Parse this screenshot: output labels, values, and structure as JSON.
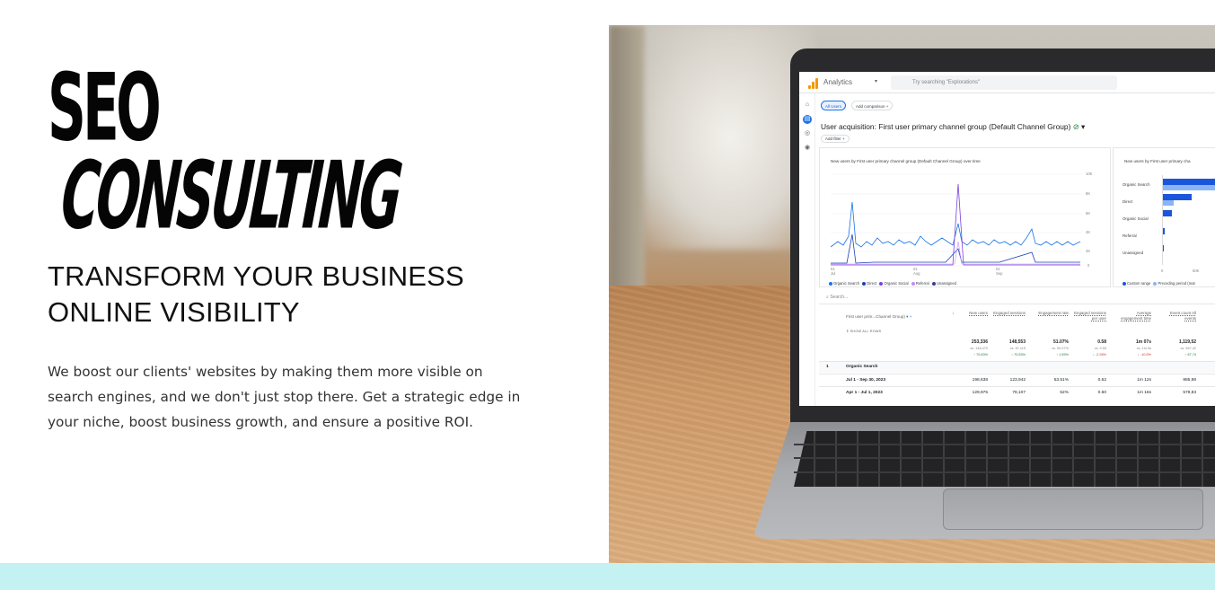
{
  "hero": {
    "title_line1": "SEO",
    "title_line2": "CONSULTING",
    "subtitle": "TRANSFORM YOUR BUSINESS ONLINE VISIBILITY",
    "description": "We boost our clients' websites by making them more visible on search engines, and we don't just stop there. Get a strategic edge in your niche, boost business growth, and ensure a positive ROI."
  },
  "colors": {
    "title_text": "#050505",
    "bottom_strip": "#c4f2f2",
    "ga_blue": "#1a73e8",
    "ga_orange": "#f29900"
  },
  "analytics": {
    "app_name": "Analytics",
    "search_placeholder": "Try searching \"Explorations\"",
    "chip_all_users": "All Users",
    "chip_add_comparison": "Add comparison",
    "heading": "User acquisition: First user primary channel group (Default Channel Group)",
    "add_filter": "Add filter",
    "line_chart_title": "New users by First user primary channel group (Default Channel Group) over time",
    "bar_chart_title": "New users by First user primary cha",
    "y_ticks": [
      "10K",
      "8K",
      "6K",
      "4K",
      "2K",
      "0"
    ],
    "x_ticks": [
      {
        "day": "01",
        "month": "Jul"
      },
      {
        "day": "01",
        "month": "Aug"
      },
      {
        "day": "01",
        "month": "Sep"
      }
    ],
    "line_legend": [
      "Organic Search",
      "Direct",
      "Organic Social",
      "Referral",
      "Unassigned"
    ],
    "bar_categories": [
      "Organic Search",
      "Direct",
      "Organic Social",
      "Referral",
      "Unassigned"
    ],
    "bar_x_ticks": [
      "0",
      "50K"
    ],
    "bar_legend": [
      "Custom range",
      "Preceding period (mat"
    ],
    "table": {
      "search": "Search...",
      "dimension_header": "First user prim...Channel Group)",
      "show_all_rows": "SHOW ALL ROWS",
      "columns": [
        "New users",
        "Engaged sessions",
        "Engagement rate",
        "Engaged sessions per user",
        "Average engagement time",
        "Event count All events"
      ],
      "totals": [
        "253,336",
        "148,553",
        "51.07%",
        "0.58",
        "1m 07s",
        "1,119,52"
      ],
      "totals_vs": [
        "vs. 148,470",
        "vs. 87,115",
        "vs. 50.27%",
        "vs. 0.59",
        "vs. 1m 9s",
        "vs. 667,42"
      ],
      "totals_change": [
        "↑ 70.63%",
        "↑ 70.53%",
        "↑ 1.59%",
        "↓ -2.28%",
        "↓ -10.5%",
        "↑ 67.74"
      ],
      "rows": [
        {
          "index": "1",
          "label": "Organic Search",
          "cells": [
            "",
            "",
            "",
            "",
            "",
            ""
          ]
        },
        {
          "index": "",
          "label": "Jul 1 - Sep 30, 2023",
          "cells": [
            "198,638",
            "123,942",
            "53.51%",
            "0.62",
            "1m 12s",
            "885,98"
          ]
        },
        {
          "index": "",
          "label": "Apr 1 - Jul 1, 2023",
          "cells": [
            "129,975",
            "78,107",
            "52%",
            "0.60",
            "1m 16s",
            "578,83"
          ]
        }
      ]
    }
  }
}
